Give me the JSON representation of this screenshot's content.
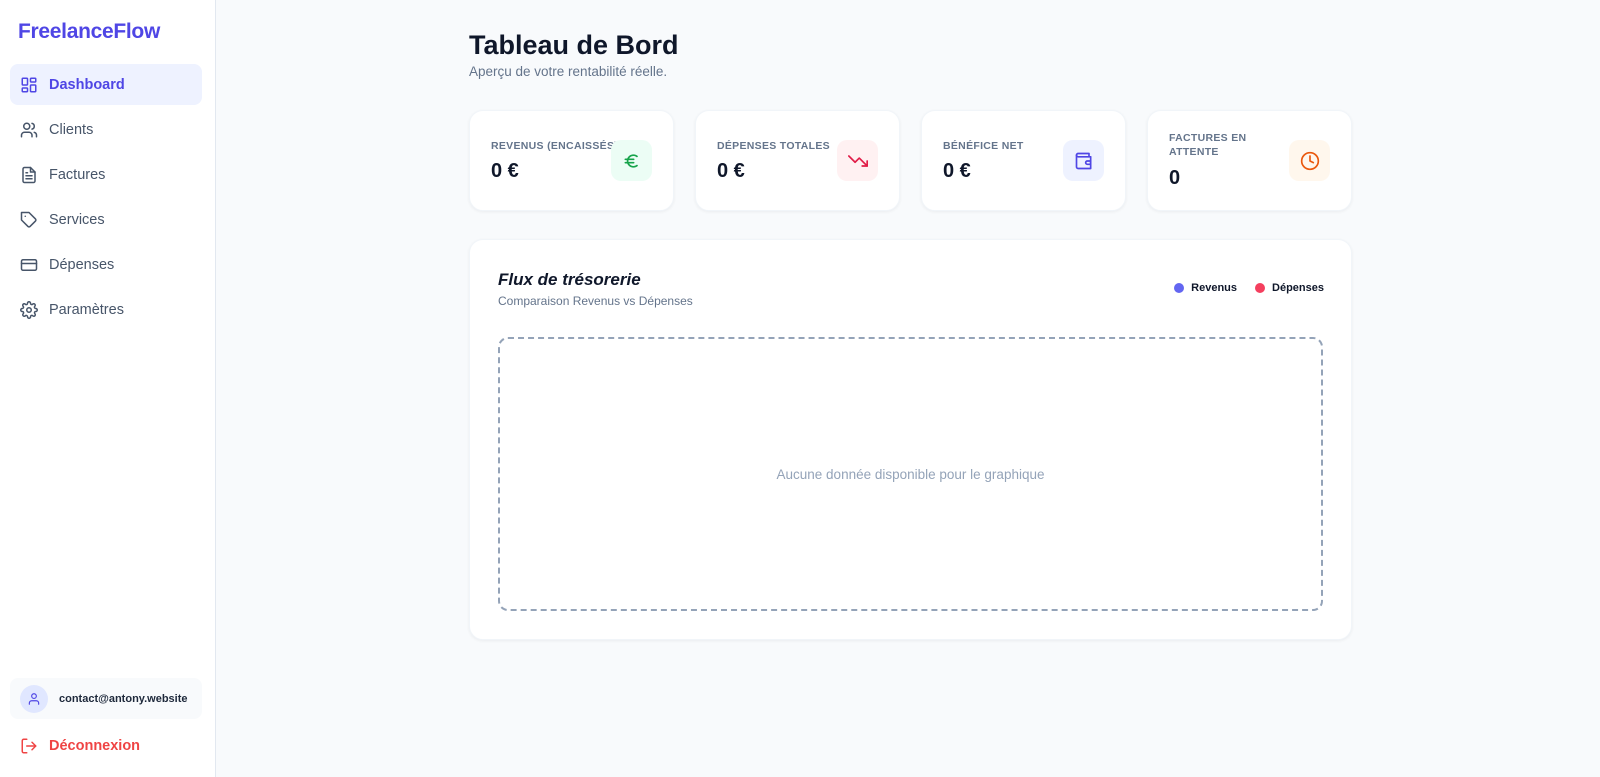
{
  "app": {
    "name": "FreelanceFlow"
  },
  "sidebar": {
    "items": [
      {
        "label": "Dashboard",
        "icon": "dashboard-icon",
        "active": true
      },
      {
        "label": "Clients",
        "icon": "users-icon"
      },
      {
        "label": "Factures",
        "icon": "file-text-icon"
      },
      {
        "label": "Services",
        "icon": "tag-icon"
      },
      {
        "label": "Dépenses",
        "icon": "credit-card-icon"
      },
      {
        "label": "Paramètres",
        "icon": "gear-icon"
      }
    ],
    "user_email": "contact@antony.website",
    "logout_label": "Déconnexion"
  },
  "header": {
    "title": "Tableau de Bord",
    "subtitle": "Aperçu de votre rentabilité réelle."
  },
  "stats": [
    {
      "label": "Revenus (encaissés)",
      "value": "0 €",
      "icon": "euro-icon",
      "color": "#16a34a",
      "bg": "#ecfdf5"
    },
    {
      "label": "Dépenses totales",
      "value": "0 €",
      "icon": "trending-down-icon",
      "color": "#e11d48",
      "bg": "#fff1f2"
    },
    {
      "label": "Bénéfice net",
      "value": "0 €",
      "icon": "wallet-icon",
      "color": "#4f46e5",
      "bg": "#eef2ff"
    },
    {
      "label": "Factures en attente",
      "value": "0",
      "icon": "clock-icon",
      "color": "#ea580c",
      "bg": "#fff7ed"
    }
  ],
  "chart": {
    "title": "Flux de trésorerie",
    "subtitle": "Comparaison Revenus vs Dépenses",
    "legend": [
      {
        "label": "Revenus",
        "color": "#6366f1"
      },
      {
        "label": "Dépenses",
        "color": "#f43f5e"
      }
    ],
    "empty_text": "Aucune donnée disponible pour le graphique"
  },
  "colors": {
    "accent": "#4f46e5",
    "danger": "#ef4444"
  }
}
